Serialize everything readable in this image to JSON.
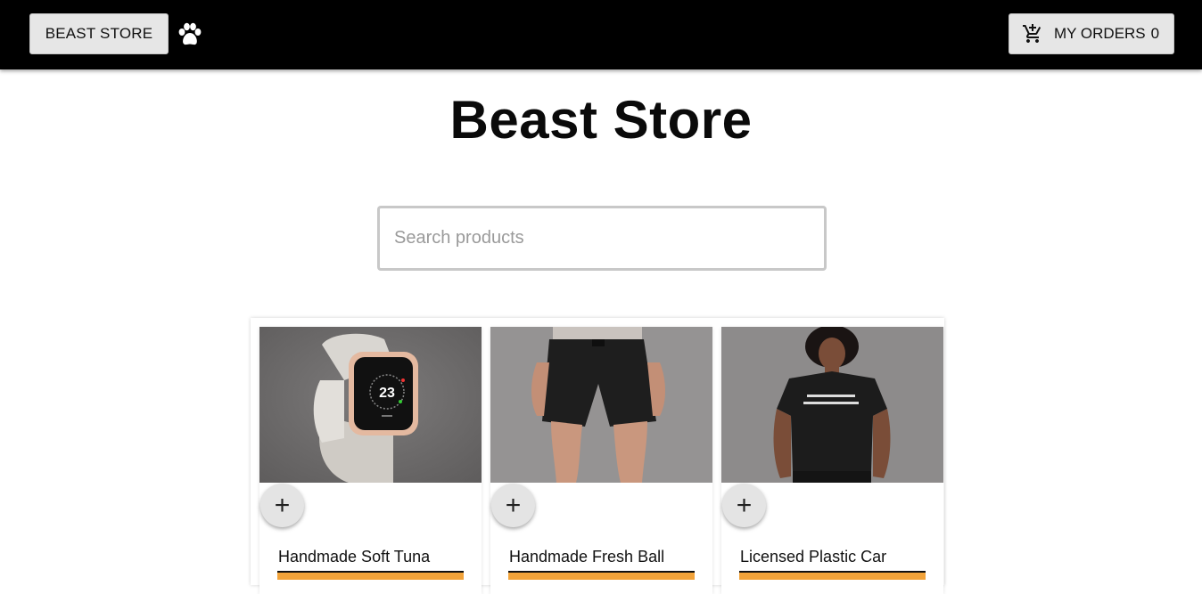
{
  "header": {
    "store_button_label": "BEAST STORE",
    "paw_icon": "paw-icon",
    "orders_label": "MY ORDERS",
    "orders_count": "0",
    "cart_icon": "cart-add-icon"
  },
  "main": {
    "title": "Beast Store",
    "search": {
      "placeholder": "Search products",
      "value": ""
    }
  },
  "products": [
    {
      "name": "Handmade Soft Tuna",
      "image": "smartwatch",
      "add_icon": "plus-icon"
    },
    {
      "name": "Handmade Fresh Ball",
      "image": "black-shorts",
      "add_icon": "plus-icon"
    },
    {
      "name": "Licensed Plastic Car",
      "image": "black-tshirt",
      "add_icon": "plus-icon"
    }
  ],
  "colors": {
    "header_bg": "#000000",
    "button_bg": "#e6e6e6",
    "accent": "#f2a33a"
  }
}
